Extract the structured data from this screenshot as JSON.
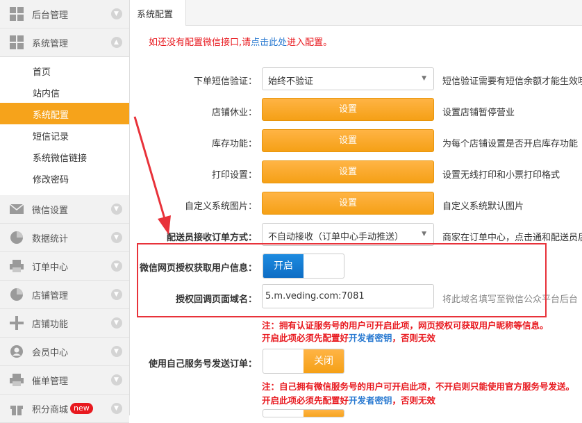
{
  "sidebar": {
    "groups": [
      {
        "label": "后台管理",
        "icon": "grid-icon",
        "arrow": "▼"
      },
      {
        "label": "系统管理",
        "icon": "grid-icon",
        "arrow": "▲"
      },
      {
        "label": "微信设置",
        "icon": "mail-icon",
        "arrow": "▼"
      },
      {
        "label": "数据统计",
        "icon": "pie-icon",
        "arrow": "▼"
      },
      {
        "label": "订单中心",
        "icon": "printer-icon",
        "arrow": "▼"
      },
      {
        "label": "店铺管理",
        "icon": "pie-icon",
        "arrow": "▼"
      },
      {
        "label": "店铺功能",
        "icon": "plus-icon",
        "arrow": "▼"
      },
      {
        "label": "会员中心",
        "icon": "user-icon",
        "arrow": "▼"
      },
      {
        "label": "催单管理",
        "icon": "printer-icon",
        "arrow": "▼"
      },
      {
        "label": "积分商城",
        "icon": "gift-icon",
        "arrow": "▼",
        "badge": "new"
      }
    ],
    "sub_items": [
      "首页",
      "站内信",
      "系统配置",
      "短信记录",
      "系统微信链接",
      "修改密码"
    ],
    "active_sub": "系统配置"
  },
  "tab": {
    "label": "系统配置"
  },
  "notice": {
    "text1": "如还没有配置微信接口,请",
    "link": "点击此处",
    "text2": "进入配置。"
  },
  "form": {
    "sms": {
      "label": "下单短信验证：",
      "value": "始终不验证",
      "hint": "短信验证需要有短信余额才能生效哦"
    },
    "rest": {
      "label": "店铺休业：",
      "button": "设置",
      "hint": "设置店铺暂停营业"
    },
    "stock": {
      "label": "库存功能：",
      "button": "设置",
      "hint": "为每个店铺设置是否开启库存功能"
    },
    "print": {
      "label": "打印设置：",
      "button": "设置",
      "hint": "设置无线打印和小票打印格式"
    },
    "image": {
      "label": "自定义系统图片：",
      "button": "设置",
      "hint": "自定义系统默认图片"
    },
    "courier": {
      "label": "配送员接收订单方式：",
      "value": "不自动接收（订单中心手动推送）",
      "hint": "商家在订单中心，点击通和配送员后"
    },
    "oauth": {
      "label": "微信网页授权获取用户信息：",
      "on": "开启"
    },
    "domain": {
      "label": "授权回调页面域名：",
      "value": "5.m.veding.com:7081",
      "hint": "将此域名填写至微信公众平台后台"
    },
    "oauth_note1": "注：拥有认证服务号的用户可开启此项，网页授权可获取用户昵称等信息。",
    "oauth_note2a": "开启此项必须先配置好",
    "oauth_note2_link": "开发者密钥",
    "oauth_note2b": "，否则无效",
    "ownsvc": {
      "label": "使用自己服务号发送订单：",
      "off": "关闭"
    },
    "ownsvc_note1": "注：自己拥有微信服务号的用户可开启此项，不开启则只能使用官方服务号发送。",
    "ownsvc_note2a": "开启此项必须先配置好",
    "ownsvc_note2_link": "开发者密钥",
    "ownsvc_note2b": "，否则无效"
  },
  "colors": {
    "accent": "#f6a31b",
    "blue": "#0e6dc4",
    "red": "#e8191f",
    "annotation": "#e8323a"
  }
}
